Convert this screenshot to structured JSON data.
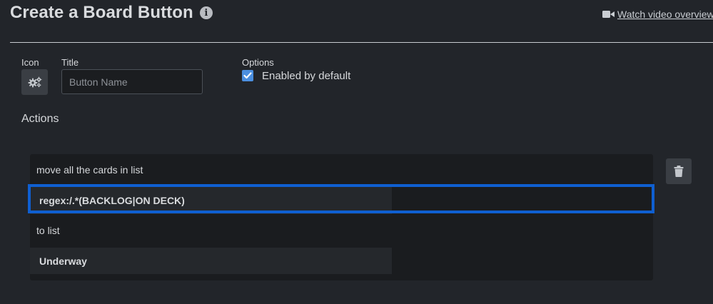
{
  "header": {
    "title": "Create a Board Button",
    "info_icon": "info-circle-icon",
    "video_link": "Watch video overview",
    "video_icon": "video-camera-icon"
  },
  "form": {
    "icon_label": "Icon",
    "icon_name": "gears-icon",
    "title_label": "Title",
    "title_value": "",
    "title_placeholder": "Button Name",
    "options_label": "Options",
    "enabled_label": "Enabled by default",
    "enabled_checked": true
  },
  "actions": {
    "heading": "Actions",
    "items": [
      {
        "text_before": "move all the cards in list",
        "list_filter": "regex:/.*(BACKLOG|ON DECK)",
        "text_middle": "to list",
        "target_list": "Underway"
      }
    ],
    "delete_icon": "trash-icon"
  },
  "colors": {
    "background": "#22252a",
    "card": "#1a1c1f",
    "accent_focus": "#0f5fd1",
    "checkbox": "#4b8fe0"
  }
}
